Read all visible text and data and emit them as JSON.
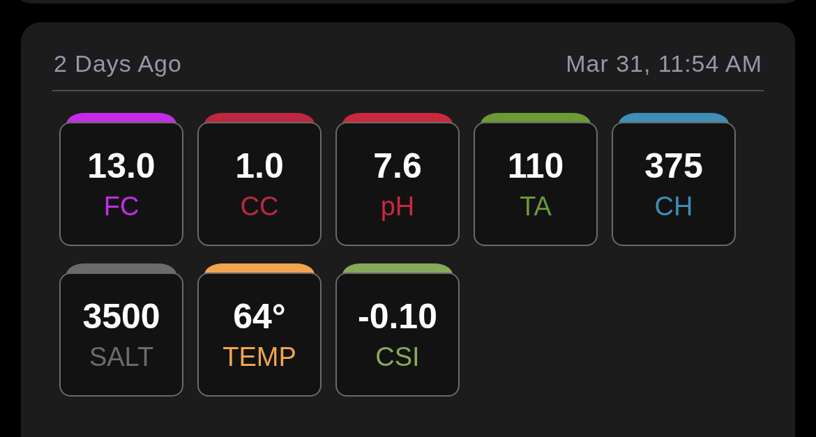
{
  "reading": {
    "relative_time": "2 Days Ago",
    "timestamp": "Mar 31, 11:54 AM"
  },
  "tests": [
    {
      "value": "13.0",
      "label": "FC",
      "color": "#c42ce8"
    },
    {
      "value": "1.0",
      "label": "CC",
      "color": "#bb2840"
    },
    {
      "value": "7.6",
      "label": "pH",
      "color": "#c8293e"
    },
    {
      "value": "110",
      "label": "TA",
      "color": "#6b9a37"
    },
    {
      "value": "375",
      "label": "CH",
      "color": "#3e8eb6"
    },
    {
      "value": "3500",
      "label": "SALT",
      "color": "#6b6b6b"
    },
    {
      "value": "64°",
      "label": "TEMP",
      "color": "#f0a54e"
    },
    {
      "value": "-0.10",
      "label": "CSI",
      "color": "#86aa5a"
    }
  ]
}
